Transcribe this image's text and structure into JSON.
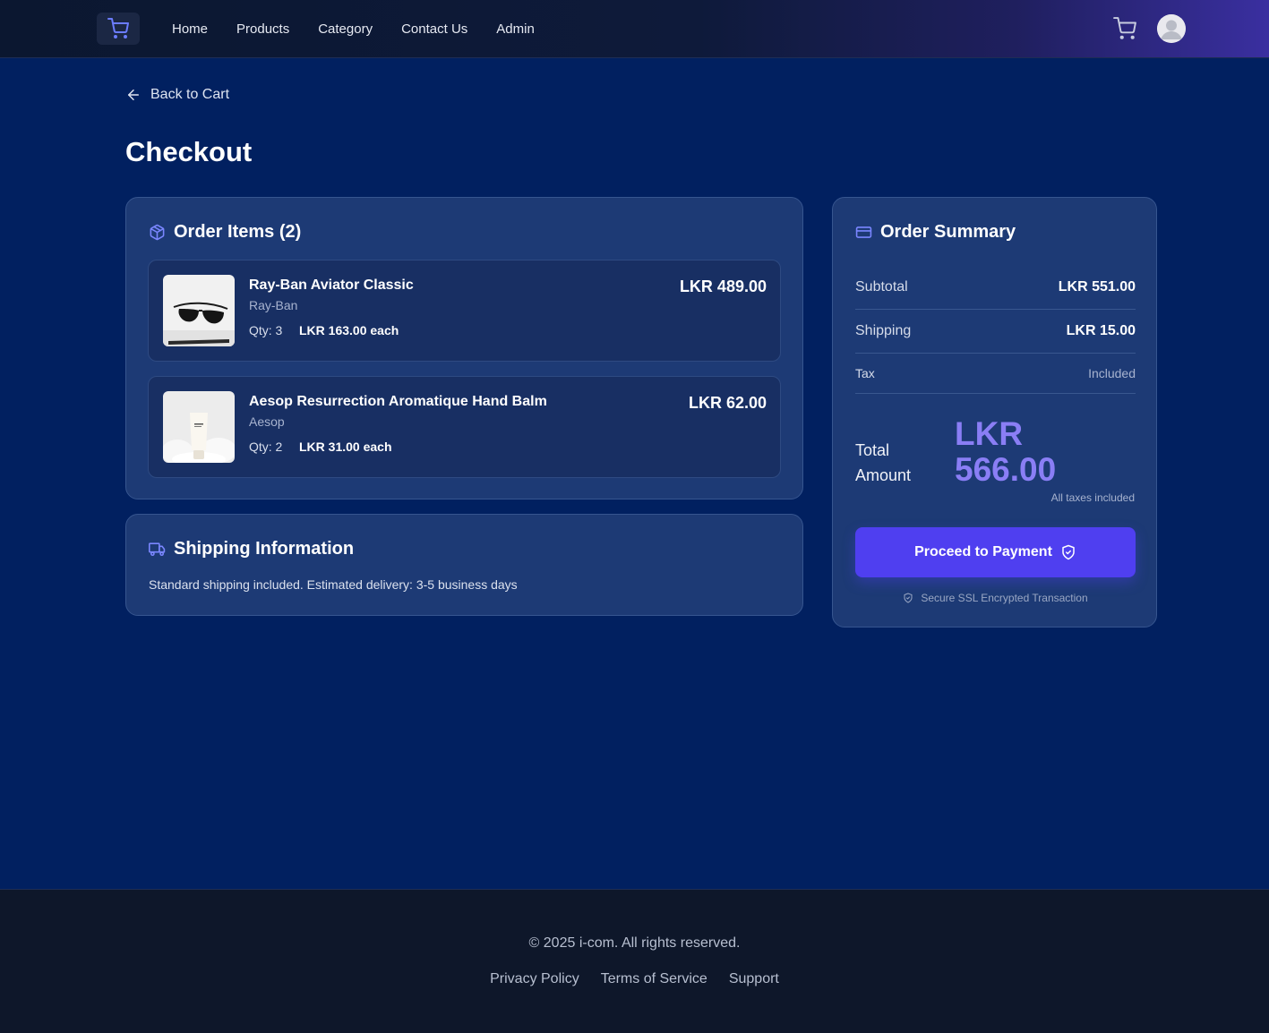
{
  "nav": {
    "logo_icon": "cart-icon",
    "links": [
      "Home",
      "Products",
      "Category",
      "Contact Us",
      "Admin"
    ],
    "cart_icon": "cart-icon",
    "avatar_icon": "user-avatar-icon"
  },
  "back": {
    "label": "Back to Cart",
    "icon": "arrow-left-icon"
  },
  "page_title": "Checkout",
  "order_items": {
    "title": "Order Items (2)",
    "icon": "package-icon",
    "items": [
      {
        "name": "Ray-Ban Aviator Classic",
        "brand": "Ray-Ban",
        "qty": "Qty: 3",
        "each": "LKR 163.00 each",
        "total": "LKR 489.00"
      },
      {
        "name": "Aesop Resurrection Aromatique Hand Balm",
        "brand": "Aesop",
        "qty": "Qty: 2",
        "each": "LKR 31.00 each",
        "total": "LKR 62.00"
      }
    ]
  },
  "shipping": {
    "title": "Shipping Information",
    "icon": "truck-icon",
    "text": "Standard shipping included. Estimated delivery: 3-5 business days"
  },
  "summary": {
    "title": "Order Summary",
    "icon": "credit-card-icon",
    "subtotal_label": "Subtotal",
    "subtotal_value": "LKR 551.00",
    "shipping_label": "Shipping",
    "shipping_value": "LKR 15.00",
    "tax_label": "Tax",
    "tax_value": "Included",
    "total_label_1": "Total",
    "total_label_2": "Amount",
    "total_currency": "LKR",
    "total_value": "566.00",
    "total_note": "All taxes included",
    "pay_button": "Proceed to Payment",
    "pay_icon": "shield-check-icon",
    "secure_text": "Secure SSL Encrypted Transaction"
  },
  "footer": {
    "copyright": "© 2025 i-com. All rights reserved.",
    "links": [
      "Privacy Policy",
      "Terms of Service",
      "Support"
    ]
  },
  "colors": {
    "page_bg": "#012060",
    "card_bg": "#1d3a75",
    "accent": "#4f3ff0",
    "total_accent": "#8a7ef5",
    "footer_bg": "#0e172a"
  }
}
